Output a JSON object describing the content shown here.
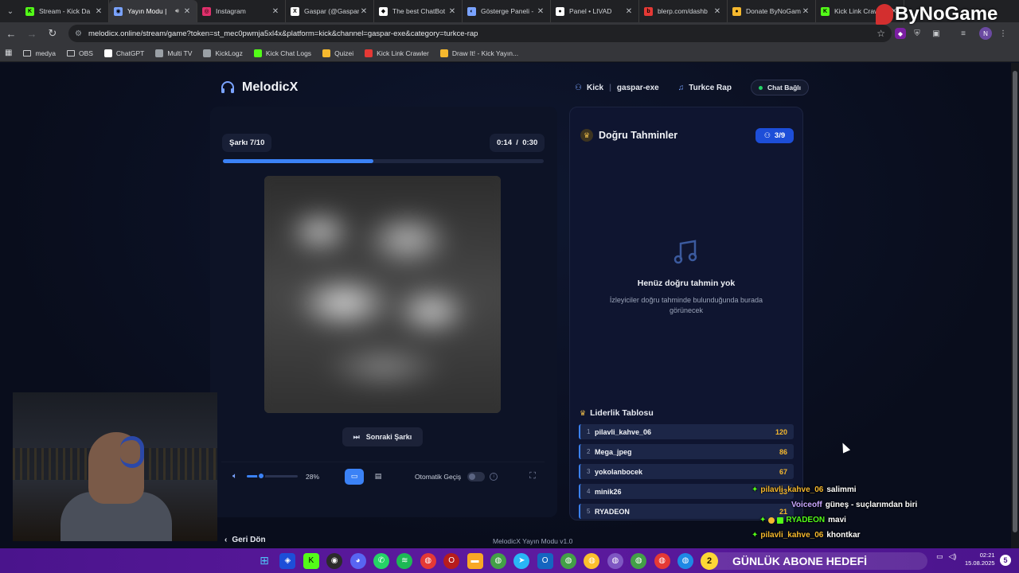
{
  "browser": {
    "tabs": [
      {
        "title": "Stream - Kick Da",
        "favicon_color": "#53fc18",
        "favicon_glyph": "K",
        "active": false
      },
      {
        "title": "Yayın Modu | ",
        "favicon_color": "#7aa3ff",
        "favicon_glyph": "◉",
        "active": true
      },
      {
        "title": "Instagram",
        "favicon_color": "#e1306c",
        "favicon_glyph": "◎",
        "active": false
      },
      {
        "title": "Gaspar (@Gaspar",
        "favicon_color": "#ffffff",
        "favicon_glyph": "X",
        "active": false
      },
      {
        "title": "The best ChatBot",
        "favicon_color": "#ffffff",
        "favicon_glyph": "◆",
        "active": false
      },
      {
        "title": "Gösterge Paneli -",
        "favicon_color": "#7aa3ff",
        "favicon_glyph": "◐",
        "active": false
      },
      {
        "title": "Panel • LIVAD",
        "favicon_color": "#ffffff",
        "favicon_glyph": "●",
        "active": false
      },
      {
        "title": "blerp.com/dashb",
        "favicon_color": "#e53935",
        "favicon_glyph": "b",
        "active": false
      },
      {
        "title": "Donate ByNoGam",
        "favicon_color": "#f5b82e",
        "favicon_glyph": "●",
        "active": false
      },
      {
        "title": "Kick Link Crawle",
        "favicon_color": "#53fc18",
        "favicon_glyph": "K",
        "active": false
      }
    ],
    "close_glyph": "✕",
    "url": "melodicx.online/stream/game?token=st_mec0pwmja5xl4x&platform=kick&channel=gaspar-exe&category=turkce-rap",
    "profile_initial": "N",
    "bookmarks": [
      {
        "label": "medya",
        "kind": "folder"
      },
      {
        "label": "OBS",
        "kind": "folder"
      },
      {
        "label": "ChatGPT",
        "kind": "site",
        "color": "#ffffff"
      },
      {
        "label": "Multi TV",
        "kind": "site",
        "color": "#9aa0a6"
      },
      {
        "label": "KickLogz",
        "kind": "site",
        "color": "#9aa0a6"
      },
      {
        "label": "Kick Chat Logs",
        "kind": "site",
        "color": "#53fc18"
      },
      {
        "label": "Quizei",
        "kind": "site",
        "color": "#f5b82e"
      },
      {
        "label": "Kick Link Crawler",
        "kind": "site",
        "color": "#e53935"
      },
      {
        "label": "Draw It! - Kick Yayın...",
        "kind": "site",
        "color": "#f5b82e"
      }
    ]
  },
  "app": {
    "brand": "MelodicX",
    "platform": "Kick",
    "channel": "gaspar-exe",
    "category": "Turkce Rap",
    "chat_status": "Chat Bağlı",
    "song_counter": "Şarkı 7/10",
    "elapsed": "0:14",
    "duration": "0:30",
    "progress_fraction": 0.47,
    "next_label": "Sonraki Şarkı",
    "volume_percent": 28,
    "volume_label": "28%",
    "auto_label": "Otomatik Geçiş",
    "auto_enabled": false,
    "correct_title": "Doğru Tahminler",
    "correct_count": "3/9",
    "empty_title": "Henüz doğru tahmin yok",
    "empty_sub": "İzleyiciler doğru tahminde bulunduğunda burada görünecek",
    "leaderboard_title": "Liderlik Tablosu",
    "leaderboard": [
      {
        "rank": "1",
        "name": "pilavli_kahve_06",
        "points": "120"
      },
      {
        "rank": "2",
        "name": "Mega_jpeg",
        "points": "86"
      },
      {
        "rank": "3",
        "name": "yokolanbocek",
        "points": "67"
      },
      {
        "rank": "4",
        "name": "minik26",
        "points": "33"
      },
      {
        "rank": "5",
        "name": "RYADEON",
        "points": "21"
      }
    ],
    "back_label": "Geri Dön",
    "version": "MelodicX Yayın Modu v1.0",
    "accent": "#3b82f6",
    "gold": "#f5b82e"
  },
  "overlay": {
    "brand": "ByNoGame",
    "chat": [
      {
        "user": "pilavli_kahve_06",
        "user_color": "#f5b82e",
        "message": "salimmi",
        "badge": "kick"
      },
      {
        "user": "Voiceoff",
        "user_color": "#c9a7ff",
        "message": "güneş - suçlarımdan biri",
        "badge": "none"
      },
      {
        "user": "RYADEON",
        "user_color": "#53fc18",
        "message": "mavi",
        "badge": "multi"
      },
      {
        "user": "pilavli_kahve_06",
        "user_color": "#f5b82e",
        "message": "khontkar",
        "badge": "kick"
      }
    ]
  },
  "taskbar": {
    "goal_number": "2",
    "goal_label": "GÜNLÜK ABONE HEDEFİ",
    "time": "02:21",
    "date": "15.08.2025",
    "notification_count": "5"
  }
}
